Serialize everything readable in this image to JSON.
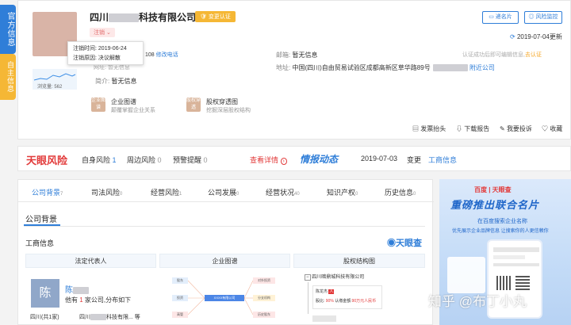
{
  "side_tabs": {
    "info": "官方信息",
    "self": "自主信息"
  },
  "company": {
    "name_prefix": "四川",
    "name_suffix": "科技有限公司",
    "verify_badge": "变更认证",
    "status_tag": "注销",
    "tooltip_cancel_time_label": "注销时间:",
    "tooltip_cancel_time": "2019-06-24",
    "tooltip_cancel_reason_label": "注销原因:",
    "tooltip_cancel_reason": "决议解散",
    "views_label": "浏览量:",
    "views": "562",
    "phone_suffix": "108",
    "phone_edit": "修改电话",
    "website_label": "网址:",
    "website": "暂无信息",
    "email_label": "邮箱:",
    "email": "暂无信息",
    "address_label": "地址:",
    "address": "中国(四川)自由贸易试验区成都高新区草华路89号",
    "nearby": "附近公司",
    "intro_label": "简介:",
    "intro": "暂无信息",
    "cert_notice": "认证成功后即可编辑信息,",
    "cert_link": "去认证",
    "update_date": "2019-07-04更新"
  },
  "top_buttons": {
    "card": "递名片",
    "monitor": "风险监控"
  },
  "features": [
    {
      "icon": "graph-icon",
      "tile": "企业图谱",
      "title": "企业图谱",
      "desc": "颠覆掌握企业关系"
    },
    {
      "icon": "equity-icon",
      "tile": "股权穿透",
      "title": "股权穿透图",
      "desc": "挖掘深层股权结构"
    }
  ],
  "actions": [
    {
      "label": "发票抬头",
      "icon": "invoice-icon"
    },
    {
      "label": "下载报告",
      "icon": "download-icon"
    },
    {
      "label": "我要投诉",
      "icon": "complaint-icon"
    },
    {
      "label": "收藏",
      "icon": "star-icon"
    }
  ],
  "risk": {
    "logo": "天眼风险",
    "self_risk": "自身风险",
    "self_count": "1",
    "around_risk": "周边风险",
    "around_count": "0",
    "warning": "预警提醒",
    "warning_count": "0",
    "detail": "查看详情",
    "dynamic_logo": "情报动态",
    "date": "2019-07-03",
    "change": "变更",
    "change_link": "工商信息"
  },
  "tabs": [
    {
      "label": "公司背景",
      "count": "7"
    },
    {
      "label": "司法风险",
      "count": "0"
    },
    {
      "label": "经营风险",
      "count": "1"
    },
    {
      "label": "公司发展",
      "count": "0"
    },
    {
      "label": "经营状况",
      "count": "40"
    },
    {
      "label": "知识产权",
      "count": "0"
    },
    {
      "label": "历史信息",
      "count": "0"
    }
  ],
  "section": {
    "title": "公司背景",
    "subtitle": "工商信息",
    "brand": "天眼查"
  },
  "columns": {
    "legal": "法定代表人",
    "graph": "企业图谱",
    "equity": "股权结构图"
  },
  "legal_person": {
    "avatar": "陈",
    "name": "陈",
    "desc_prefix": "他有",
    "desc_count": "1",
    "desc_suffix": "家公司,分布如下",
    "region": "四川(共1家)",
    "company_prefix": "四川",
    "company_suffix": "科技有限...",
    "more": "等"
  },
  "graph_nodes": {
    "center": "XXXX有限公司",
    "n1": "股东",
    "n2": "投资",
    "n3": "高管",
    "n4": "对外投资",
    "n5": "分支机构",
    "n6": "历史股东"
  },
  "equity": {
    "company": "四川暗鼎城科技有限公司",
    "holder": "陈龙杰",
    "ratio_label": "股比:",
    "ratio": "90%",
    "sub_label": "认缴金额:",
    "sub": "90万元人民币"
  },
  "ad": {
    "logos": "百度 | 天眼查",
    "headline": "重磅推出联合名片",
    "line1": "在百度搜索企业名称",
    "line2": "优先展示企业品牌信息 让搜索你的人更信赖你"
  },
  "watermark": "知乎 @布丁小丸"
}
